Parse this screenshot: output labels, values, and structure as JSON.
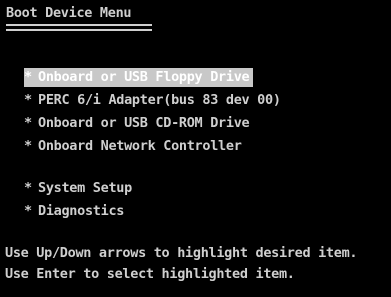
{
  "screen": {
    "title": "Boot Device Menu"
  },
  "menu": {
    "bullet": "*",
    "devices": [
      {
        "label": "Onboard or USB Floppy Drive",
        "selected": true
      },
      {
        "label": "PERC 6/i Adapter(bus 83 dev 00)",
        "selected": false
      },
      {
        "label": "Onboard or USB CD-ROM Drive",
        "selected": false
      },
      {
        "label": "Onboard Network Controller",
        "selected": false
      }
    ],
    "options": [
      {
        "label": "System Setup"
      },
      {
        "label": "Diagnostics"
      }
    ]
  },
  "help": {
    "line1": "Use Up/Down arrows to highlight desired item.",
    "line2": "Use Enter to select highlighted item."
  },
  "colors": {
    "background": "#000000",
    "text": "#cfcfcf",
    "highlight_bg": "#c8c8c8",
    "highlight_text": "#ffffff"
  }
}
